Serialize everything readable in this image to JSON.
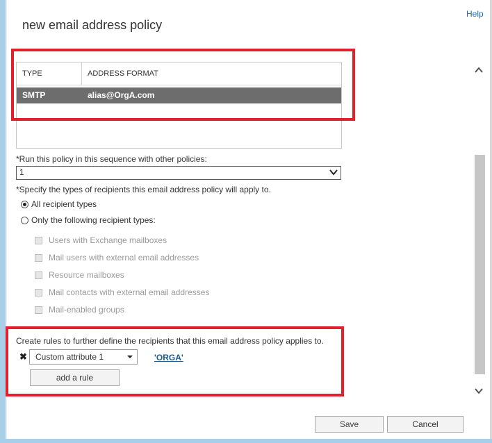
{
  "dialog": {
    "title": "new email address policy",
    "help_label": "Help"
  },
  "address_table": {
    "headers": [
      "TYPE",
      "ADDRESS FORMAT"
    ],
    "rows": [
      [
        "SMTP",
        "alias@OrgA.com"
      ]
    ]
  },
  "sequence": {
    "label": "*Run this policy in this sequence with other policies:",
    "value": "1"
  },
  "recipients": {
    "label": "*Specify the types of recipients this email address policy will apply to.",
    "options": [
      {
        "label": "All recipient types",
        "checked": true
      },
      {
        "label": "Only the following recipient types:",
        "checked": false
      }
    ],
    "types": [
      "Users with Exchange mailboxes",
      "Mail users with external email addresses",
      "Resource mailboxes",
      "Mail contacts with external email addresses",
      "Mail-enabled groups"
    ]
  },
  "rules": {
    "label": "Create rules to further define the recipients that this email address policy applies to.",
    "remove_glyph": "✖",
    "attribute": "Custom attribute 1",
    "value_link": "'ORGA'",
    "add_rule_label": "add a rule"
  },
  "footer": {
    "save_label": "Save",
    "cancel_label": "Cancel"
  },
  "colors": {
    "highlight_box": "#e0202a",
    "selected_row": "#6d6d6d",
    "link": "#1a6fb5"
  }
}
